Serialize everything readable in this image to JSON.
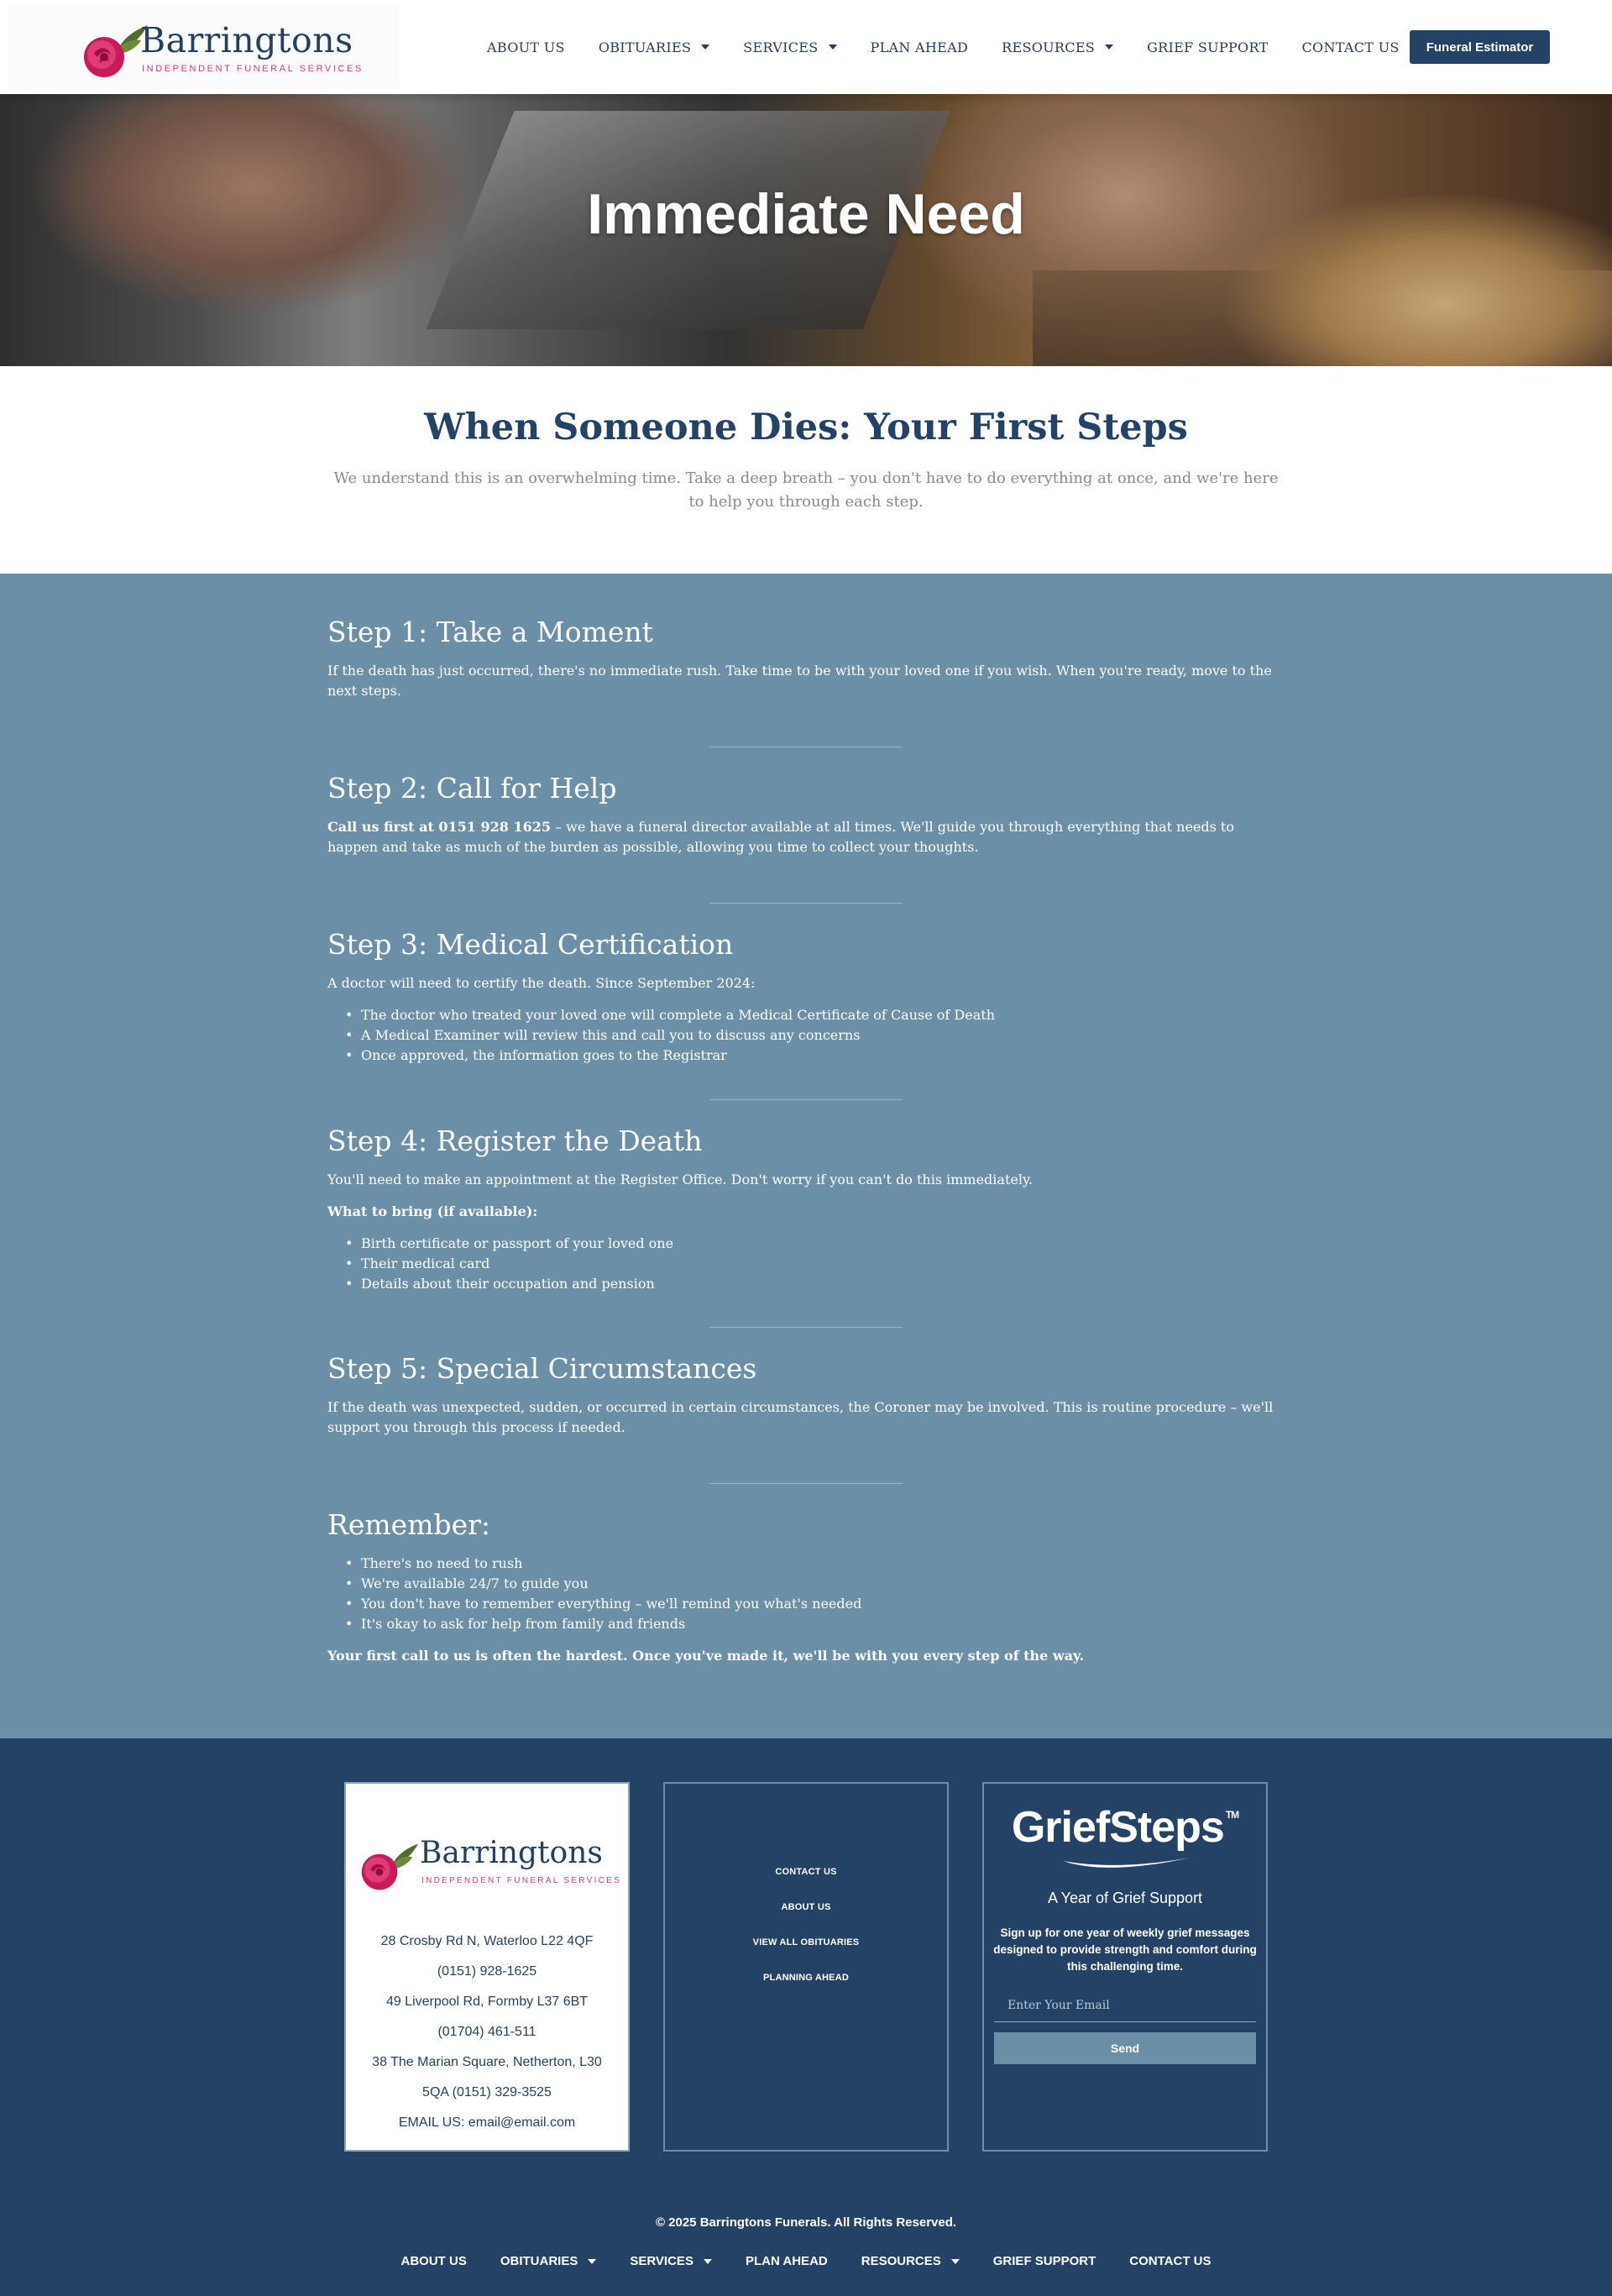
{
  "brand": {
    "name": "Barringtons",
    "tagline": "INDEPENDENT FUNERAL SERVICES",
    "accent_color": "#d23c7c",
    "primary_color": "#234266",
    "steps_bg_color": "#6b8fa7"
  },
  "nav": {
    "items": [
      {
        "label": "ABOUT US"
      },
      {
        "label": "OBITUARIES"
      },
      {
        "label": "SERVICES"
      },
      {
        "label": "PLAN AHEAD"
      },
      {
        "label": "RESOURCES"
      },
      {
        "label": "GRIEF SUPPORT"
      },
      {
        "label": "CONTACT US"
      }
    ],
    "cta_label": "Funeral Estimator"
  },
  "hero": {
    "title": "Immediate Need"
  },
  "intro": {
    "heading": "When Someone Dies: Your First Steps",
    "text": "We understand this is an overwhelming time. Take a deep breath – you don't have to do everything at once, and we're here to help you through each step."
  },
  "steps": {
    "s1": {
      "title": "Step 1: Take a Moment",
      "text": "If the death has just occurred, there's no immediate rush. Take time to be with your loved one if you wish. When you're ready, move to the next steps."
    },
    "s2": {
      "title": "Step 2: Call for Help",
      "bold": "Call us first at 0151 928 1625",
      "text": " – we have a funeral director available at all times. We'll guide you through everything that needs to happen and take as much of the burden as possible, allowing you time to collect your thoughts."
    },
    "s3": {
      "title": "Step 3: Medical Certification",
      "text": "A doctor will need to certify the death. Since September 2024:",
      "items": [
        "The doctor who treated your loved one will complete a Medical Certificate of Cause of Death",
        "A Medical Examiner will review this and call you to discuss any concerns",
        "Once approved, the information goes to the Registrar"
      ]
    },
    "s4": {
      "title": "Step 4: Register the Death",
      "text": "You'll need to make an appointment at the Register Office. Don't worry if you can't do this immediately.",
      "bring_label": "What to bring (if available):",
      "items": [
        "Birth certificate or passport of your loved one",
        "Their medical card",
        "Details about their occupation and pension"
      ]
    },
    "s5": {
      "title": "Step 5: Special Circumstances",
      "text": "If the death was unexpected, sudden, or occurred in certain circumstances, the Coroner may be involved. This is routine procedure – we'll support you through this process if needed."
    },
    "remember": {
      "title": "Remember:",
      "items": [
        "There's no need to rush",
        "We're available 24/7 to guide you",
        "You don't have to remember everything – we'll remind you what's needed",
        "It's okay to ask for help from family and friends"
      ],
      "closing": "Your first call to us is often the hardest. Once you've made it, we'll be with you every step of the way."
    }
  },
  "footer": {
    "contact": {
      "lines": [
        "28 Crosby Rd N, Waterloo L22 4QF",
        "(0151) 928-1625",
        "49 Liverpool Rd, Formby L37 6BT",
        "(01704) 461-511",
        "38 The Marian Square, Netherton, L30",
        "5QA (0151) 329-3525",
        "EMAIL US: email@email.com"
      ]
    },
    "links": [
      "CONTACT US",
      "ABOUT US",
      "VIEW ALL OBITUARIES",
      "PLANNING AHEAD"
    ],
    "griefsteps": {
      "logo": "GriefSteps",
      "tm": "TM",
      "subtitle": "A Year of Grief Support",
      "description": "Sign up for one year of weekly grief messages designed to provide strength and comfort during this challenging time.",
      "email_placeholder": "Enter Your Email",
      "send_label": "Send"
    },
    "copyright": "© 2025 Barringtons Funerals. All Rights Reserved.",
    "nav": [
      {
        "label": "ABOUT US"
      },
      {
        "label": "OBITUARIES"
      },
      {
        "label": "SERVICES"
      },
      {
        "label": "PLAN AHEAD"
      },
      {
        "label": "RESOURCES"
      },
      {
        "label": "GRIEF SUPPORT"
      },
      {
        "label": "CONTACT US"
      }
    ]
  }
}
